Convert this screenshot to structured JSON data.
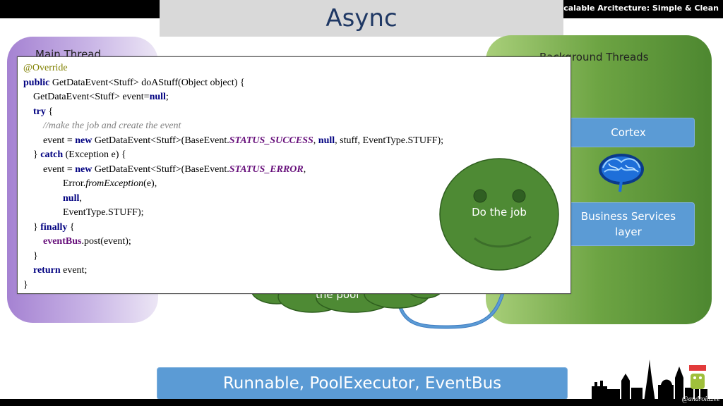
{
  "header": {
    "text": "Scalable Arcitecture: Simple & Clean"
  },
  "slide": {
    "title": "Async",
    "main_thread_label": "Main Thread",
    "background_threads_label": "Background Threads",
    "cortex_label": "Cortex",
    "business_services_label_line1": "Business Services",
    "business_services_label_line2": "layer",
    "pool_label": "the pool",
    "job_label": "Do the job",
    "bottom_label": "Runnable, PoolExecutor, EventBus",
    "handle": "@android2ee"
  },
  "code": {
    "l1": "@Override",
    "l2_kw": "public",
    "l2_rest": " GetDataEvent<Stuff> doAStuff(Object object) {",
    "l3_a": "    GetDataEvent<Stuff> event=",
    "l3_kw": "null",
    "l3_b": ";",
    "l4_kw": "try",
    "l4_rest": " {",
    "l5": "        //make the job and create the event",
    "l6_a": "        event = ",
    "l6_kw": "new",
    "l6_b": " GetDataEvent<Stuff>(BaseEvent.",
    "l6_st": "STATUS_SUCCESS",
    "l6_c": ", ",
    "l6_kw2": "null",
    "l6_d": ", stuff, EventType.STUFF);",
    "l7_a": "    } ",
    "l7_kw": "catch",
    "l7_rest": " (Exception e) {",
    "l8_a": "        event = ",
    "l8_kw": "new",
    "l8_b": " GetDataEvent<Stuff>(BaseEvent.",
    "l8_st": "STATUS_ERROR",
    "l8_c": ",",
    "l9_a": "                Error.",
    "l9_mt": "fromException",
    "l9_b": "(e),",
    "l10_kw": "null",
    "l10_b": ",",
    "l11": "                EventType.STUFF);",
    "l12_a": "    } ",
    "l12_kw": "finally",
    "l12_rest": " {",
    "l13_fd": "eventBus",
    "l13_b": ".post(event);",
    "l14": "    }",
    "l15_kw": "return",
    "l15_rest": " event;",
    "l16": "}"
  },
  "colors": {
    "title": "#1f3864",
    "blue_box": "#5b9bd5",
    "smiley": "#4e8a34",
    "cloud": "#4e8a34",
    "arrow": "#5b9bd5"
  }
}
